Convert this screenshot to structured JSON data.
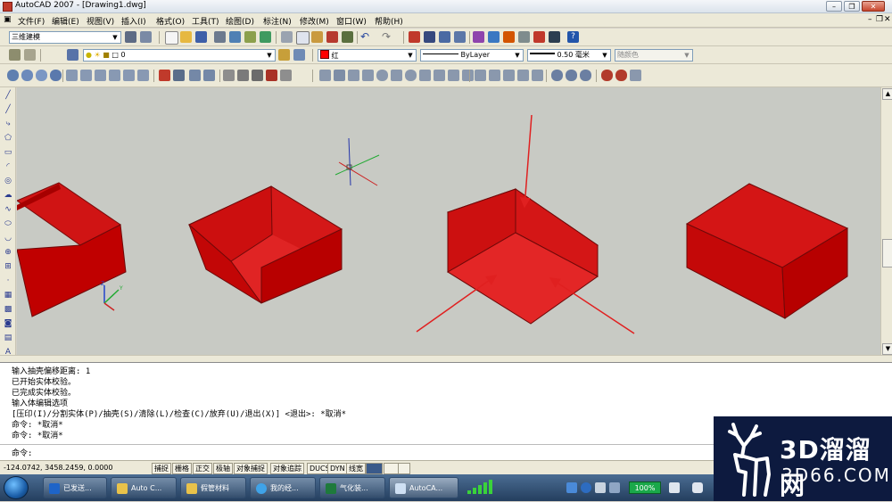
{
  "window": {
    "title": "AutoCAD 2007 - [Drawing1.dwg]"
  },
  "menu": [
    "文件(F)",
    "编辑(E)",
    "视图(V)",
    "插入(I)",
    "格式(O)",
    "工具(T)",
    "绘图(D)",
    "标注(N)",
    "修改(M)",
    "窗口(W)",
    "帮助(H)"
  ],
  "toolbar": {
    "workspace": "三维建模",
    "layer": "0",
    "color": "红",
    "linetype": "ByLayer",
    "lineweight": "0.50 毫米",
    "plotstyle": "随颜色"
  },
  "command_history": [
    "输入抽壳偏移距离: 1",
    "已开始实体校验。",
    "已完成实体校验。",
    "输入体编辑选项",
    "[压印(I)/分割实体(P)/抽壳(S)/清除(L)/检查(C)/放弃(U)/退出(X)] <退出>: *取消*",
    "命令: *取消*",
    "命令: *取消*"
  ],
  "command_prompt": "命令:",
  "status": {
    "coordinates": "-124.0742,  3458.2459, 0.0000",
    "toggles": [
      "捕捉",
      "栅格",
      "正交",
      "极轴",
      "对象捕捉",
      "对象追踪",
      "DUCS",
      "DYN",
      "线宽"
    ]
  },
  "taskbar": {
    "tasks": [
      {
        "label": "已发送...",
        "icon": "outlook-icon",
        "color": "#1e64c8"
      },
      {
        "label": "Auto C...",
        "icon": "folder-icon",
        "color": "#e8c24a"
      },
      {
        "label": "假管材料",
        "icon": "folder-icon",
        "color": "#e8c24a"
      },
      {
        "label": "我的经...",
        "icon": "ie-icon",
        "color": "#3fa3e8"
      },
      {
        "label": "气化装...",
        "icon": "excel-icon",
        "color": "#1e7a3c"
      },
      {
        "label": "AutoCA...",
        "icon": "autocad-icon",
        "color": "#cfe0f3"
      }
    ],
    "battery": "100%"
  },
  "watermark": {
    "brand": "3D溜溜网",
    "domain": "3D66.COM"
  },
  "colors": {
    "solid_red": "#cc0000",
    "arrow_red": "#e02020",
    "drawing_bg": "#c8cac4"
  }
}
